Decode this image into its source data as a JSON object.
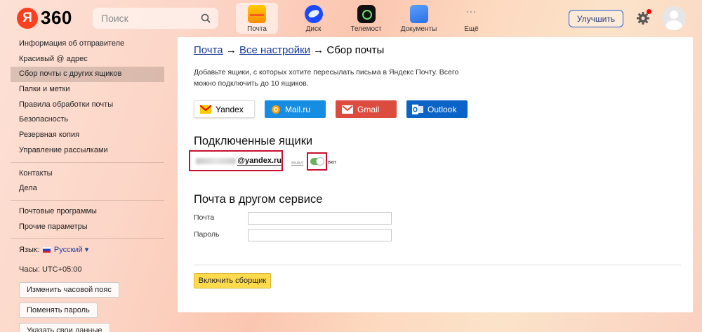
{
  "header": {
    "logo_badge": "Я",
    "logo_text": "360",
    "search_placeholder": "Поиск",
    "services": [
      {
        "label": "Почта",
        "icon": "mail-icon",
        "active": true
      },
      {
        "label": "Диск",
        "icon": "disk-icon"
      },
      {
        "label": "Телемост",
        "icon": "telemost-icon"
      },
      {
        "label": "Документы",
        "icon": "documents-icon"
      },
      {
        "label": "Ещё",
        "icon": "more-icon",
        "glyph": "⋯"
      }
    ],
    "upgrade_label": "Улучшить"
  },
  "sidebar": {
    "items": [
      "Информация об отправителе",
      "Красивый @ адрес",
      "Сбор почты с других ящиков",
      "Папки и метки",
      "Правила обработки почты",
      "Безопасность",
      "Резервная копия",
      "Управление рассылками",
      "Контакты",
      "Дела",
      "Почтовые программы",
      "Прочие параметры"
    ],
    "language_label": "Язык:",
    "language_value": "Русский",
    "language_caret": "▾",
    "clock_label": "Часы: UTC+05:00",
    "buttons": [
      "Изменить часовой пояс",
      "Поменять пароль",
      "Указать свои данные"
    ]
  },
  "main": {
    "breadcrumb": {
      "link1": "Почта",
      "arrow1": " → ",
      "link2": "Все настройки",
      "arrow2": " → ",
      "current": "Сбор почты"
    },
    "description": "Добавьте ящики, с которых хотите пересылать письма в Яндекс Почту. Всего можно подключить до 10 ящиков.",
    "providers": [
      "Yandex",
      "Mail.ru",
      "Gmail",
      "Outlook"
    ],
    "connected_title": "Подключенные ящики",
    "connected_email": "@yandex.ru",
    "toggle_off_label": "выкл",
    "toggle_on_label": "вкл",
    "toggle_state": "on",
    "other_title": "Почта в другом сервисе",
    "fields": [
      {
        "label": "Почта",
        "value": ""
      },
      {
        "label": "Пароль",
        "value": ""
      }
    ],
    "enable_button": "Включить сборщик"
  },
  "colors": {
    "accent_red": "#c8102e",
    "mailru": "#168de2",
    "gmail": "#db4c3f",
    "outlook": "#0a64c8",
    "yellow_button": "#ffdb4d",
    "toggle_on": "#66b35a"
  }
}
